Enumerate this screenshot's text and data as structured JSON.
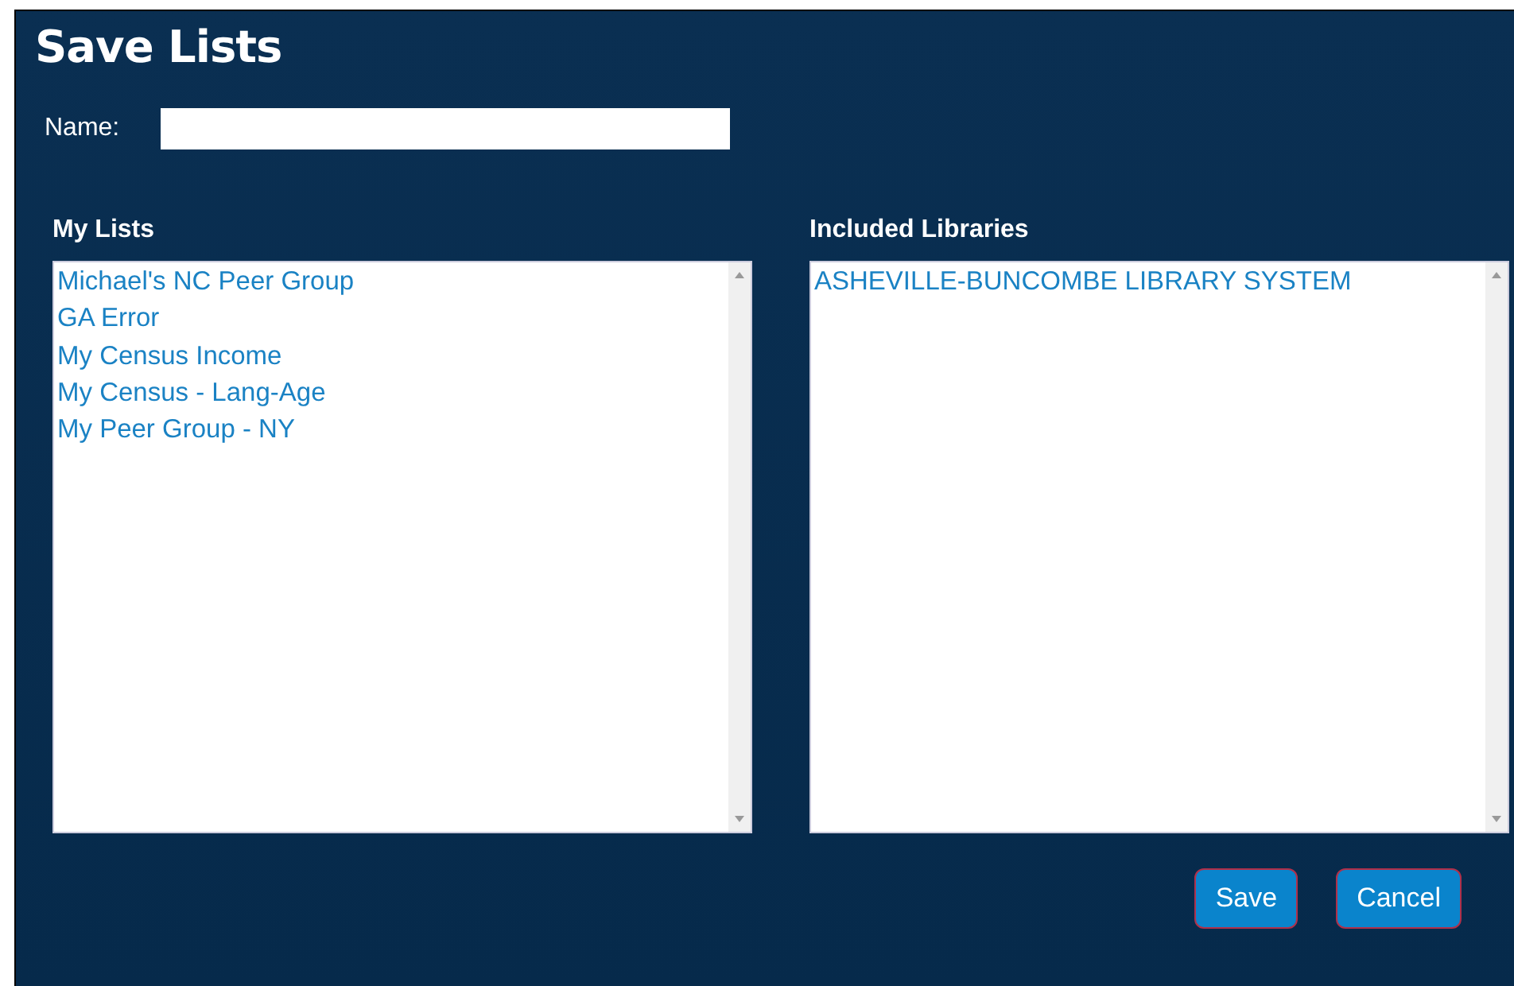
{
  "dialog": {
    "title": "Save Lists"
  },
  "name_field": {
    "label": "Name:"
  },
  "my_lists": {
    "heading": "My Lists",
    "items": [
      {
        "label": "Michael's NC Peer Group",
        "selected": false
      },
      {
        "label": "GA Error",
        "selected": false
      },
      {
        "label": "My Census Income",
        "selected": false
      },
      {
        "label": "My Census - Lang-Age",
        "selected": false
      },
      {
        "label": "My Peer Group - NY",
        "selected": false
      }
    ]
  },
  "included_libraries": {
    "heading": "Included Libraries",
    "items": [
      {
        "label": "ASHEVILLE-BUNCOMBE LIBRARY SYSTEM",
        "selected": false
      }
    ]
  },
  "buttons": [
    {
      "label": "Save"
    },
    {
      "label": "Cancel"
    }
  ]
}
